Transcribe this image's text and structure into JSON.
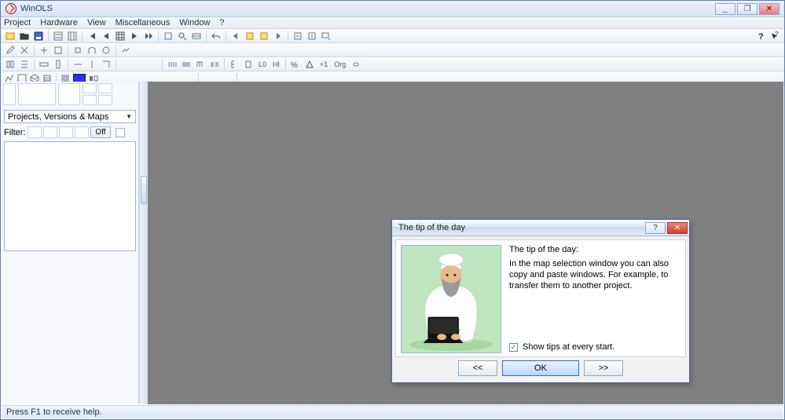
{
  "window": {
    "title": "WinOLS",
    "minimize_glyph": "_",
    "maximize_glyph": "❐",
    "close_glyph": "✕"
  },
  "menubar": {
    "items": [
      "Project",
      "Hardware",
      "View",
      "Miscellaneous",
      "Window",
      "?"
    ]
  },
  "sidebar": {
    "combo_label": "Projects, Versions & Maps",
    "combo_arrow": "▼",
    "filter_label": "Filter:",
    "off_label": "Off"
  },
  "statusbar": {
    "text": "Press F1 to receive help."
  },
  "dialog": {
    "title": "The tip of the day",
    "help_glyph": "?",
    "close_glyph": "✕",
    "heading": "The tip of the day:",
    "message": "In the map selection window you can also copy and paste windows. For example, to transfer them to another project.",
    "checkbox_checked_glyph": "✓",
    "checkbox_label": "Show tips at every start.",
    "prev_label": "<<",
    "ok_label": "OK",
    "next_label": ">>"
  },
  "toolbar_row3_text": {
    "org": "Org"
  }
}
